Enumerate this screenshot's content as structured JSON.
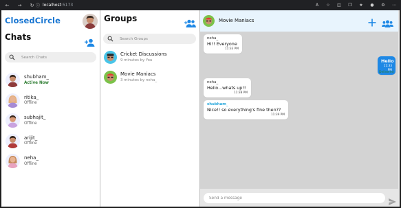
{
  "browser": {
    "url_host": "localhost",
    "url_port": ":5173"
  },
  "brand": "ClosedCircle",
  "chats": {
    "title": "Chats",
    "search_placeholder": "Search Chats",
    "items": [
      {
        "name": "shubham_",
        "status": "Active Now",
        "active": true
      },
      {
        "name": "ritika_",
        "status": "Offline",
        "active": false
      },
      {
        "name": "subhajit_",
        "status": "Offline",
        "active": false
      },
      {
        "name": "arijit_",
        "status": "Offline",
        "active": false
      },
      {
        "name": "neha_",
        "status": "Offline",
        "active": false
      }
    ]
  },
  "groups": {
    "title": "Groups",
    "search_placeholder": "Search Groups",
    "items": [
      {
        "name": "Cricket Discussions",
        "meta": "9 minutes by You"
      },
      {
        "name": "Movie Maniacs",
        "meta": "3 minutes by neha_"
      }
    ]
  },
  "conversation": {
    "title": "Movie Maniacs",
    "messages": [
      {
        "sender": "neha_",
        "text": "Hi!! Everyone",
        "time": "11:33 PM"
      },
      {
        "sender": "",
        "text": "Hello",
        "time": "11:33 PM"
      },
      {
        "sender": "neha_",
        "text": "Hello...whats up!!",
        "time": "11:38 PM"
      },
      {
        "sender": "shubham_",
        "text": "Nice!! so everything's fine then??",
        "time": "11:39 PM"
      }
    ],
    "delivered_label": "Delivered",
    "composer_placeholder": "Send a message"
  },
  "colors": {
    "brand": "#1976d2",
    "accent": "#1e88e5",
    "active_status": "#2e7d32",
    "self_sender": "#29a8dc",
    "convo_bg": "#d3d3d3",
    "header_bg": "#e8f4fd"
  },
  "icons": {
    "back": "arrow-left-icon",
    "forward": "arrow-right-icon",
    "refresh": "refresh-icon",
    "info": "info-icon",
    "add_user": "person-add-icon",
    "add_group": "group-add-icon",
    "search": "search-icon",
    "plus": "plus-icon",
    "members": "group-icon",
    "send": "send-icon"
  }
}
